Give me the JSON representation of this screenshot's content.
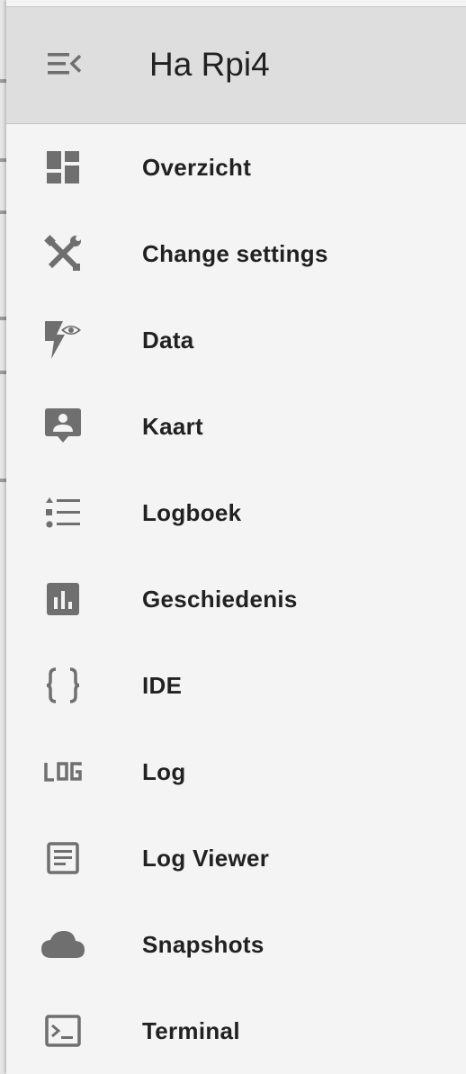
{
  "header": {
    "title": "Ha Rpi4",
    "menu_icon": "menu-collapse-icon"
  },
  "colors": {
    "icon": "#6f6f6f",
    "text": "#212121",
    "header_bg": "#dedede",
    "drawer_bg": "#f4f4f4"
  },
  "nav": {
    "items": [
      {
        "label": "Overzicht",
        "icon": "dashboard-icon"
      },
      {
        "label": "Change settings",
        "icon": "tools-icon"
      },
      {
        "label": "Data",
        "icon": "flash-eye-icon"
      },
      {
        "label": "Kaart",
        "icon": "map-marker-account-icon"
      },
      {
        "label": "Logboek",
        "icon": "format-list-bulleted-type-icon"
      },
      {
        "label": "Geschiedenis",
        "icon": "chart-box-icon"
      },
      {
        "label": "IDE",
        "icon": "code-braces-icon"
      },
      {
        "label": "Log",
        "icon": "log-text-icon"
      },
      {
        "label": "Log Viewer",
        "icon": "text-box-icon"
      },
      {
        "label": "Snapshots",
        "icon": "cloud-icon"
      },
      {
        "label": "Terminal",
        "icon": "console-icon"
      }
    ]
  }
}
